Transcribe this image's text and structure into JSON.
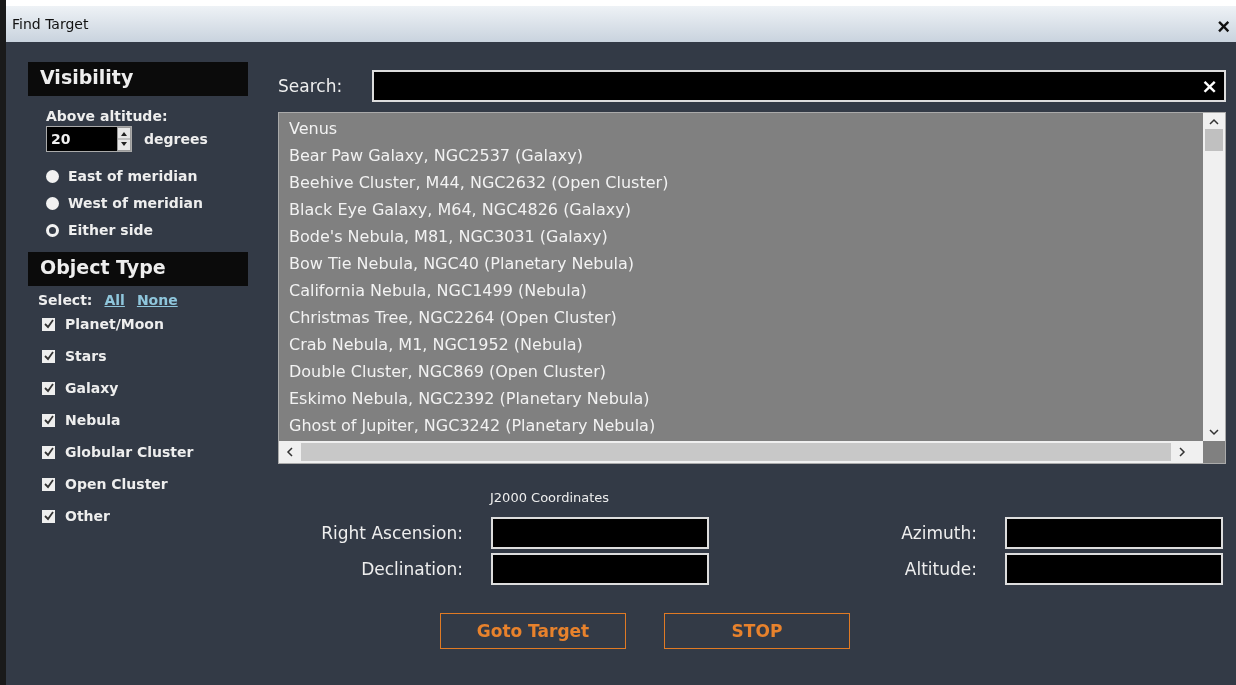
{
  "window": {
    "title": "Find Target",
    "close": "×"
  },
  "visibility": {
    "title": "Visibility",
    "altitude_label": "Above altitude:",
    "altitude_value": "20",
    "unit": "degrees",
    "options": [
      {
        "label": "East of meridian",
        "selected": false
      },
      {
        "label": "West of meridian",
        "selected": false
      },
      {
        "label": "Either side",
        "selected": true
      }
    ]
  },
  "object_type": {
    "title": "Object Type",
    "select_label": "Select:",
    "select_all": "All",
    "select_none": "None",
    "types": [
      {
        "label": "Planet/Moon",
        "checked": true
      },
      {
        "label": "Stars",
        "checked": true
      },
      {
        "label": "Galaxy",
        "checked": true
      },
      {
        "label": "Nebula",
        "checked": true
      },
      {
        "label": "Globular Cluster",
        "checked": true
      },
      {
        "label": "Open Cluster",
        "checked": true
      },
      {
        "label": "Other",
        "checked": true
      }
    ]
  },
  "search": {
    "label": "Search:",
    "clear": "×"
  },
  "results": [
    "Venus",
    "Bear Paw Galaxy, NGC2537 (Galaxy)",
    "Beehive Cluster, M44, NGC2632 (Open Cluster)",
    "Black Eye Galaxy, M64, NGC4826 (Galaxy)",
    "Bode's Nebula, M81, NGC3031 (Galaxy)",
    "Bow Tie Nebula, NGC40 (Planetary Nebula)",
    "California Nebula, NGC1499 (Nebula)",
    "Christmas Tree, NGC2264 (Open Cluster)",
    "Crab Nebula, M1, NGC1952 (Nebula)",
    "Double Cluster, NGC869 (Open Cluster)",
    "Eskimo Nebula, NGC2392 (Planetary Nebula)",
    "Ghost of Jupiter, NGC3242 (Planetary Nebula)"
  ],
  "coordinates": {
    "title": "J2000 Coordinates",
    "right_ascension": "Right Ascension:",
    "declination": "Declination:",
    "azimuth": "Azimuth:",
    "altitude": "Altitude:"
  },
  "buttons": [
    "Goto Target",
    "STOP"
  ]
}
